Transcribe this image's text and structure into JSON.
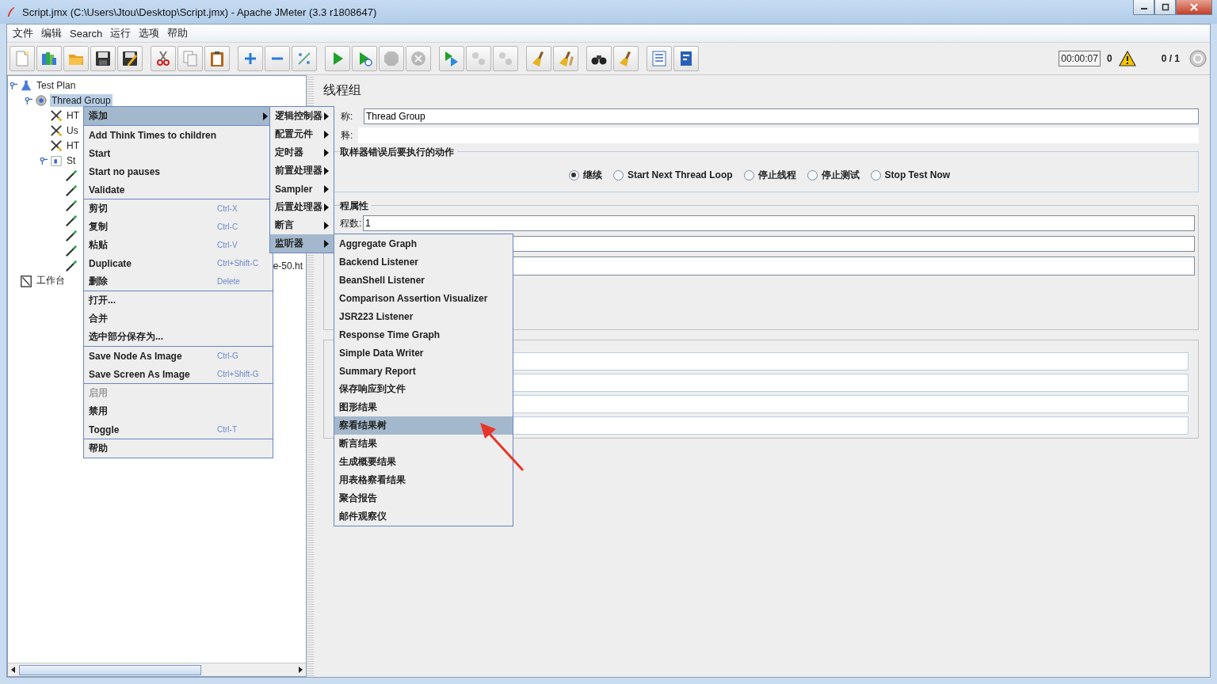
{
  "window": {
    "title": "Script.jmx (C:\\Users\\Jtou\\Desktop\\Script.jmx) - Apache JMeter (3.3 r1808647)"
  },
  "menu_bar": [
    "文件",
    "编辑",
    "Search",
    "运行",
    "选项",
    "帮助"
  ],
  "toolbar": {
    "groups": [
      [
        {
          "kind": "new",
          "disabled": false
        },
        {
          "kind": "templates",
          "disabled": false
        },
        {
          "kind": "open",
          "disabled": false
        },
        {
          "kind": "save",
          "disabled": false
        },
        {
          "kind": "save-as",
          "disabled": false
        }
      ],
      [
        {
          "kind": "cut",
          "disabled": false
        },
        {
          "kind": "copy",
          "disabled": false
        },
        {
          "kind": "paste",
          "disabled": false
        }
      ],
      [
        {
          "kind": "expand",
          "disabled": false
        },
        {
          "kind": "collapse",
          "disabled": false
        },
        {
          "kind": "toggle",
          "disabled": false
        }
      ],
      [
        {
          "kind": "start",
          "disabled": false
        },
        {
          "kind": "start-no-pauses",
          "disabled": false
        },
        {
          "kind": "stop",
          "disabled": true
        },
        {
          "kind": "shutdown",
          "disabled": true
        }
      ],
      [
        {
          "kind": "remote-start",
          "disabled": false
        },
        {
          "kind": "remote-stop",
          "disabled": true
        },
        {
          "kind": "remote-shutdown",
          "disabled": true
        }
      ],
      [
        {
          "kind": "clear",
          "disabled": false
        },
        {
          "kind": "clear-all",
          "disabled": false
        }
      ],
      [
        {
          "kind": "search",
          "disabled": false
        },
        {
          "kind": "reset-search",
          "disabled": false
        }
      ],
      [
        {
          "kind": "function-helper",
          "disabled": false
        },
        {
          "kind": "help",
          "disabled": false
        }
      ]
    ],
    "timer": "00:00:07",
    "error_count": "0",
    "threads": "0 / 1"
  },
  "tree": [
    {
      "label": "Test Plan",
      "kind": "plan",
      "selected": false,
      "children": [
        {
          "label": "Thread Group",
          "kind": "thread-group",
          "selected": true,
          "children": [
            {
              "label": "HT",
              "kind": "config",
              "selected": false
            },
            {
              "label": "Us",
              "kind": "config",
              "selected": false
            },
            {
              "label": "HT",
              "kind": "config",
              "selected": false
            },
            {
              "label": "St",
              "kind": "controller",
              "selected": false,
              "children": [
                {
                  "kind": "sampler"
                },
                {
                  "kind": "sampler"
                },
                {
                  "kind": "sampler"
                },
                {
                  "kind": "sampler"
                },
                {
                  "kind": "sampler"
                },
                {
                  "kind": "sampler"
                },
                {
                  "label": "e-50.ht",
                  "kind": "sampler",
                  "selected": false
                }
              ]
            }
          ]
        }
      ]
    },
    {
      "label": "工作台",
      "kind": "workbench",
      "selected": false
    }
  ],
  "panel": {
    "title": "线程组",
    "name_label": "称:",
    "name_value": "Thread Group",
    "comment_label": "释:",
    "error_action": {
      "title": "取样器错误后要执行的动作",
      "options": [
        {
          "label": "继续",
          "selected": true
        },
        {
          "label": "Start Next Thread Loop",
          "selected": false
        },
        {
          "label": "停止线程",
          "selected": false
        },
        {
          "label": "停止测试",
          "selected": false
        },
        {
          "label": "Stop Test Now",
          "selected": false
        }
      ]
    },
    "thread_props": {
      "title": "程属性",
      "threads_label": "程数:",
      "threads_value": "1"
    }
  },
  "context_menu": {
    "sections": [
      [
        {
          "label": "添加",
          "submenu": true,
          "selected": true,
          "disabled": false
        }
      ],
      [
        {
          "label": "Add Think Times to children",
          "submenu": false,
          "selected": false,
          "disabled": false
        },
        {
          "label": "Start",
          "submenu": false,
          "selected": false,
          "disabled": false
        },
        {
          "label": "Start no pauses",
          "submenu": false,
          "selected": false,
          "disabled": false
        },
        {
          "label": "Validate",
          "submenu": false,
          "selected": false,
          "disabled": false
        }
      ],
      [
        {
          "label": "剪切",
          "shortcut": "Ctrl-X",
          "submenu": false,
          "selected": false,
          "disabled": false
        },
        {
          "label": "复制",
          "shortcut": "Ctrl-C",
          "submenu": false,
          "selected": false,
          "disabled": false
        },
        {
          "label": "粘贴",
          "shortcut": "Ctrl-V",
          "submenu": false,
          "selected": false,
          "disabled": false
        },
        {
          "label": "Duplicate",
          "shortcut": "Ctrl+Shift-C",
          "submenu": false,
          "selected": false,
          "disabled": false
        },
        {
          "label": "删除",
          "shortcut": "Delete",
          "submenu": false,
          "selected": false,
          "disabled": false
        }
      ],
      [
        {
          "label": "打开...",
          "submenu": false,
          "selected": false,
          "disabled": false
        },
        {
          "label": "合并",
          "submenu": false,
          "selected": false,
          "disabled": false
        },
        {
          "label": "选中部分保存为...",
          "submenu": false,
          "selected": false,
          "disabled": false
        }
      ],
      [
        {
          "label": "Save Node As Image",
          "shortcut": "Ctrl-G",
          "submenu": false,
          "selected": false,
          "disabled": false
        },
        {
          "label": "Save Screen As Image",
          "shortcut": "Ctrl+Shift-G",
          "submenu": false,
          "selected": false,
          "disabled": false
        }
      ],
      [
        {
          "label": "启用",
          "submenu": false,
          "selected": false,
          "disabled": true
        },
        {
          "label": "禁用",
          "submenu": false,
          "selected": false,
          "disabled": false
        },
        {
          "label": "Toggle",
          "shortcut": "Ctrl-T",
          "submenu": false,
          "selected": false,
          "disabled": false
        }
      ],
      [
        {
          "label": "帮助",
          "submenu": false,
          "selected": false,
          "disabled": false
        }
      ]
    ]
  },
  "add_submenu": [
    {
      "label": "逻辑控制器",
      "selected": false
    },
    {
      "label": "配置元件",
      "selected": false
    },
    {
      "label": "定时器",
      "selected": false
    },
    {
      "label": "前置处理器",
      "selected": false
    },
    {
      "label": "Sampler",
      "selected": false
    },
    {
      "label": "后置处理器",
      "selected": false
    },
    {
      "label": "断言",
      "selected": false
    },
    {
      "label": "监听器",
      "selected": true
    }
  ],
  "listener_submenu": [
    {
      "label": "Aggregate Graph",
      "selected": false
    },
    {
      "label": "Backend Listener",
      "selected": false
    },
    {
      "label": "BeanShell Listener",
      "selected": false
    },
    {
      "label": "Comparison Assertion Visualizer",
      "selected": false
    },
    {
      "label": "JSR223 Listener",
      "selected": false
    },
    {
      "label": "Response Time Graph",
      "selected": false
    },
    {
      "label": "Simple Data Writer",
      "selected": false
    },
    {
      "label": "Summary Report",
      "selected": false
    },
    {
      "label": "保存响应到文件",
      "selected": false
    },
    {
      "label": "图形结果",
      "selected": false
    },
    {
      "label": "察看结果树",
      "selected": true
    },
    {
      "label": "断言结果",
      "selected": false
    },
    {
      "label": "生成概要结果",
      "selected": false
    },
    {
      "label": "用表格察看结果",
      "selected": false
    },
    {
      "label": "聚合报告",
      "selected": false
    },
    {
      "label": "邮件观察仪",
      "selected": false
    }
  ]
}
